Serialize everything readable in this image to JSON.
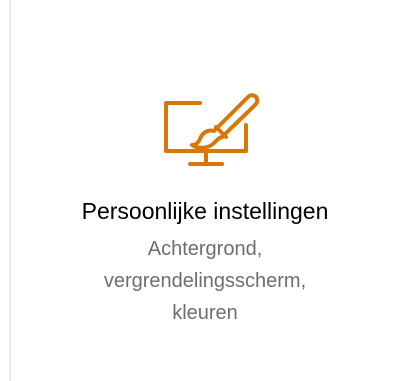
{
  "tile": {
    "title": "Persoonlijke instellingen",
    "description_lines": [
      "Achtergrond,",
      "vergrendelingsscherm,",
      "kleuren"
    ],
    "icon": "personalization-monitor-brush-icon"
  },
  "colors": {
    "accent": "#d97706",
    "title": "#000000",
    "description": "#6e6e6e",
    "divider": "#ebebeb",
    "background": "#ffffff"
  }
}
